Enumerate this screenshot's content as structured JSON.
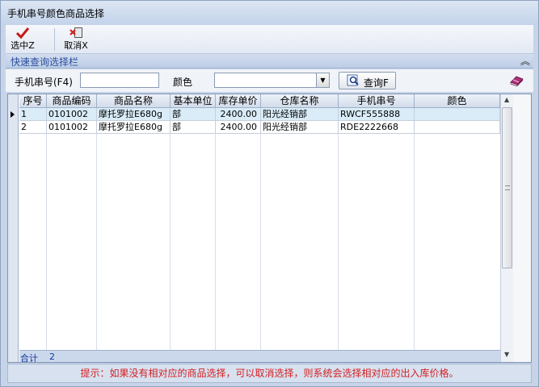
{
  "window": {
    "title": "手机串号颜色商品选择"
  },
  "toolbar": {
    "select_label": "选中Z",
    "cancel_label": "取消X"
  },
  "quickbar": {
    "title": "快速查询选择栏"
  },
  "search": {
    "serial_label": "手机串号(F4)",
    "serial_value": "",
    "color_label": "颜色",
    "color_value": "",
    "query_label": "查询F"
  },
  "grid": {
    "columns": [
      "序号",
      "商品编码",
      "商品名称",
      "基本单位",
      "库存单价",
      "仓库名称",
      "手机串号",
      "颜色"
    ],
    "rows": [
      {
        "seq": "1",
        "code": "0101002",
        "name": "摩托罗拉E680g",
        "unit": "部",
        "price": "2400.00",
        "warehouse": "阳光经销部",
        "serial": "RWCF555888",
        "color": ""
      },
      {
        "seq": "2",
        "code": "0101002",
        "name": "摩托罗拉E680g",
        "unit": "部",
        "price": "2400.00",
        "warehouse": "阳光经销部",
        "serial": "RDE2222668",
        "color": ""
      }
    ],
    "footer": {
      "label": "合计",
      "count": "2"
    }
  },
  "hint": {
    "text": "提示：如果没有相对应的商品选择，可以取消选择，则系统会选择相对应的出入库价格。"
  },
  "colors": {
    "accent": "#2a4f9e",
    "hint": "#d42020",
    "selected_row": "#d9ecf8"
  }
}
